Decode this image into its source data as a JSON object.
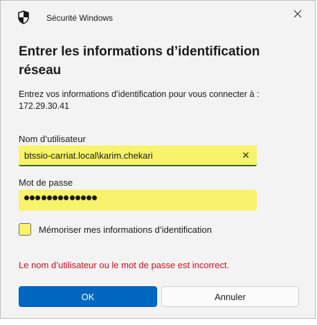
{
  "window": {
    "title": "Sécurité Windows",
    "close_label": "✕"
  },
  "dialog": {
    "heading_line1": "Entrer les informations d’identification",
    "heading_line2": "réseau",
    "description_line1": "Entrez vos informations d’identification pour vous connecter à :",
    "description_line2": "172.29.30.41"
  },
  "username": {
    "label": "Nom d’utilisateur",
    "value": "btssio-carriat.local\\karim.chekari",
    "clear_label": "✕"
  },
  "password": {
    "label": "Mot de passe",
    "masked_length": 13
  },
  "remember": {
    "label": "Mémoriser mes informations d’identification",
    "checked": false
  },
  "error_message": "Le nom d’utilisateur ou le mot de passe est incorrect.",
  "buttons": {
    "ok_label": "OK",
    "cancel_label": "Annuler"
  },
  "colors": {
    "accent": "#0067c0",
    "error": "#c50f1f",
    "highlight": "#f7f36a"
  }
}
